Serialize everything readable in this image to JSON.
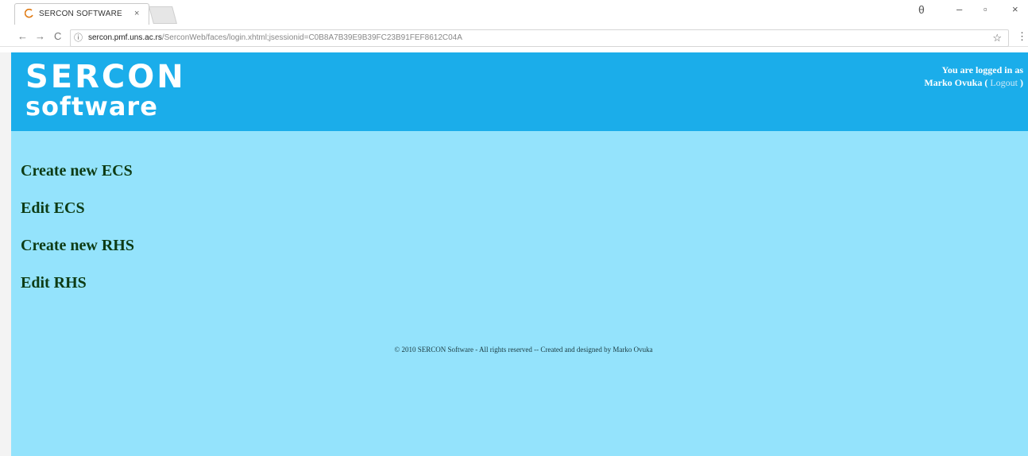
{
  "browser": {
    "tab_title": "SERCON SOFTWARE",
    "tab_close": "×",
    "url_host": "sercon.pmf.uns.ac.rs",
    "url_path": "/SerconWeb/faces/login.xhtml;jsessionid=C0B8A7B39E9B39FC23B91FEF8612C04A",
    "icons": {
      "back": "←",
      "forward": "→",
      "reload": "C",
      "info": "ⓘ",
      "star": "☆",
      "menu": "⋮",
      "profile": "θ",
      "minimize": "–",
      "restore": "▫",
      "close": "×"
    }
  },
  "header": {
    "logo_line1": "SERCON",
    "logo_line2": "software",
    "login_line1": "You are logged in as",
    "user_name": "Marko Ovuka",
    "logout_open": " ( ",
    "logout_label": "Logout",
    "logout_close": " )"
  },
  "menu": {
    "items": [
      {
        "label": "Create new ECS"
      },
      {
        "label": "Edit ECS"
      },
      {
        "label": "Create new RHS"
      },
      {
        "label": "Edit RHS"
      }
    ]
  },
  "footer": {
    "text": "© 2010 SERCON Software - All rights reserved -- Created and designed by Marko Ovuka"
  },
  "colors": {
    "header_bg": "#1badea",
    "content_bg": "#94e3fc",
    "link_text": "#0d3b14"
  }
}
